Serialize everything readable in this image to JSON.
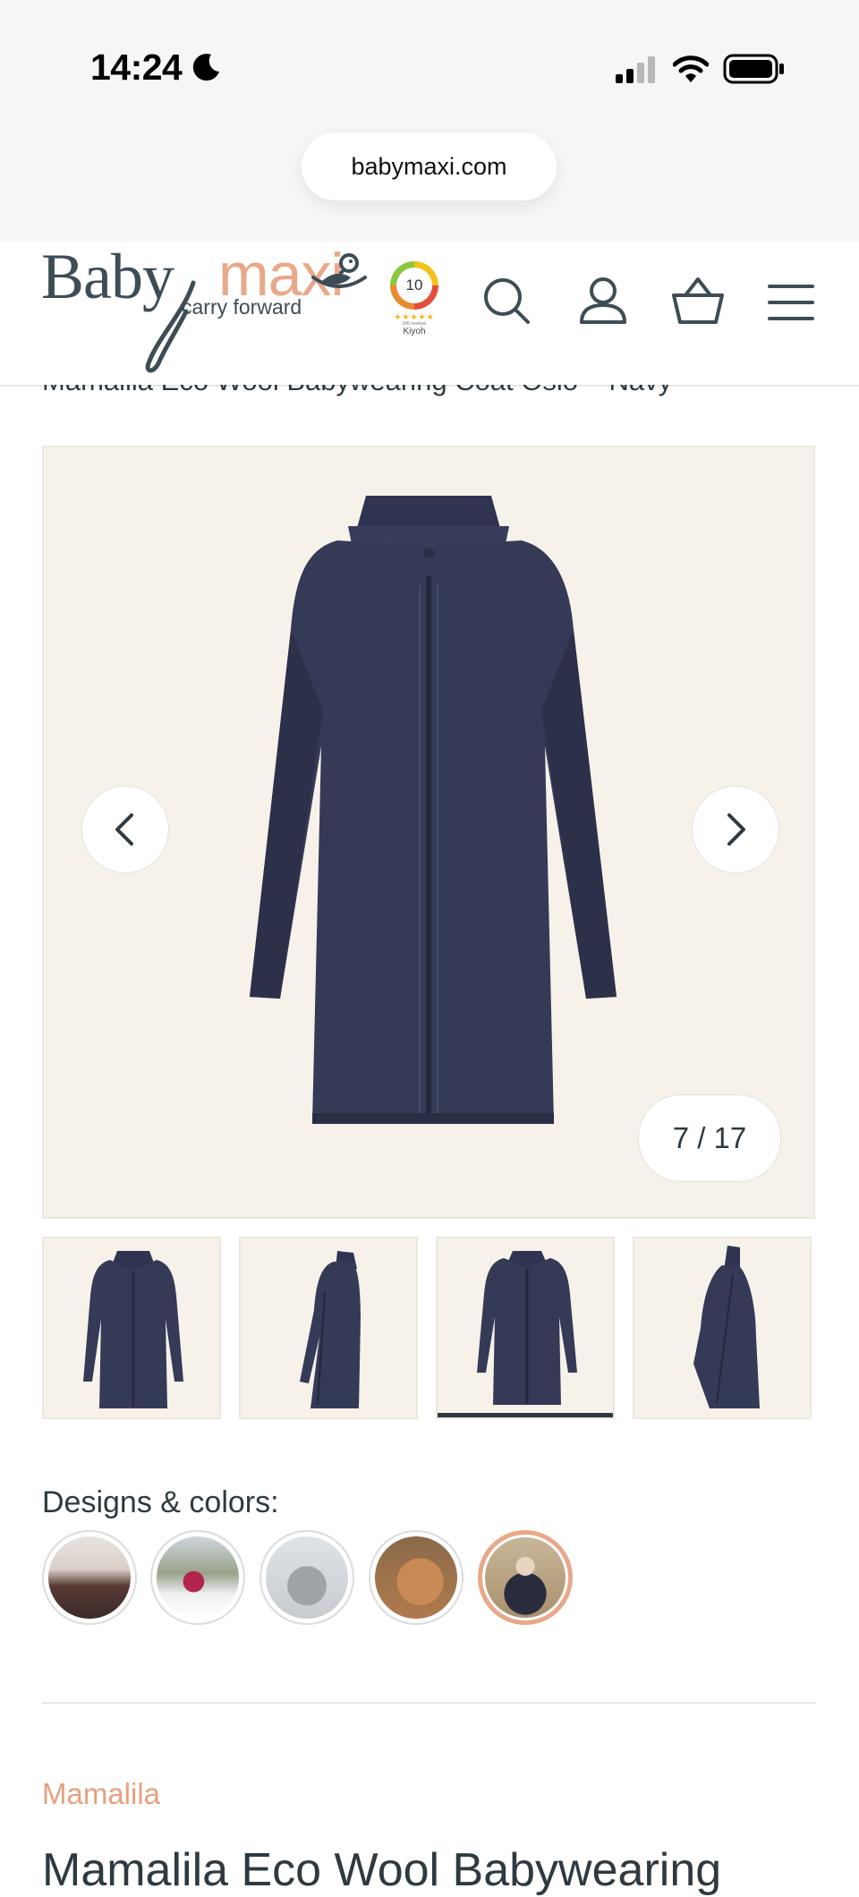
{
  "status_bar": {
    "time": "14:24",
    "url": "babymaxi.com"
  },
  "header": {
    "logo_baby": "Baby",
    "logo_maxi": "maxi",
    "logo_tagline": "carry forward",
    "kiyoh_score": "10",
    "kiyoh_stars": "★★★★★",
    "kiyoh_reviews": "345 reviews",
    "kiyoh_name": "Kiyoh",
    "icons": [
      "search-icon",
      "account-icon",
      "basket-icon",
      "menu-icon"
    ]
  },
  "product": {
    "title_top": "Mamalila Eco Wool Babywearing Coat Oslo – Navy",
    "gallery_counter": "7 / 17",
    "gallery_current": 7,
    "gallery_total": 17,
    "designs_label": "Designs & colors:",
    "brand": "Mamalila",
    "title": "Mamalila Eco Wool Babywearing"
  },
  "colors": {
    "accent": "#e8a889",
    "text": "#2e3a40",
    "coat": "#353a57",
    "image_bg": "#f6f2ea"
  }
}
